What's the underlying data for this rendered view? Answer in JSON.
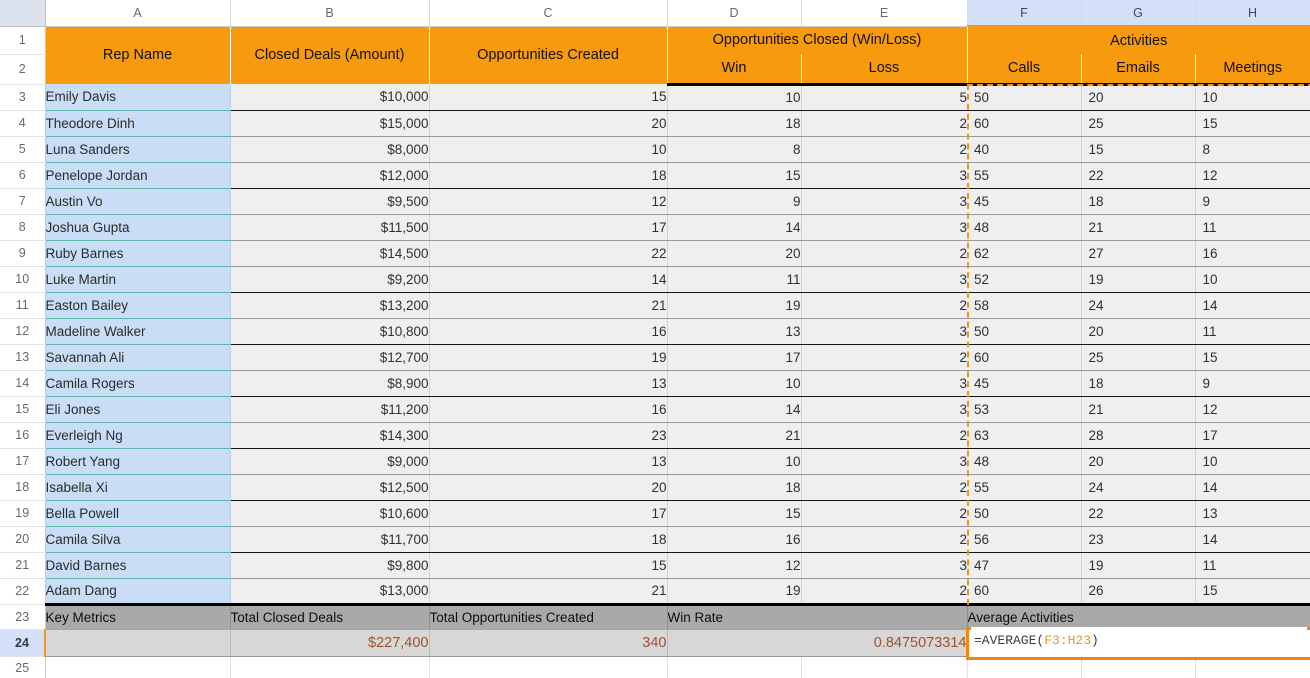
{
  "spreadsheet": {
    "column_letters": [
      "A",
      "B",
      "C",
      "D",
      "E",
      "F",
      "G",
      "H"
    ],
    "selected_columns": [
      "F",
      "G",
      "H"
    ],
    "active_row": "24",
    "row_numbers": [
      "1",
      "2",
      "3",
      "4",
      "5",
      "6",
      "7",
      "8",
      "9",
      "10",
      "11",
      "12",
      "13",
      "14",
      "15",
      "16",
      "17",
      "18",
      "19",
      "20",
      "21",
      "22",
      "23",
      "24",
      "25"
    ],
    "colors": {
      "header_orange": "#f79a0e",
      "name_column_blue": "#c9ddf7",
      "data_gray": "#efefef",
      "metric_label_gray": "#a9a9a9",
      "metric_value_gray": "#d7d7d7",
      "metric_value_text": "#a0522d",
      "selection_orange": "#f0921e",
      "column_header_selected": "#d3e0f7"
    }
  },
  "headers": {
    "rep_name": "Rep Name",
    "closed_deals": "Closed Deals (Amount)",
    "opportunities_created": "Opportunities Created",
    "opportunities_closed": "Opportunities Closed (Win/Loss)",
    "activities": "Activities",
    "win": "Win",
    "loss": "Loss",
    "calls": "Calls",
    "emails": "Emails",
    "meetings": "Meetings"
  },
  "rows": [
    {
      "row": "3",
      "name": "Emily Davis",
      "closed": "$10,000",
      "created": "15",
      "win": "10",
      "loss": "5",
      "calls": "50",
      "emails": "20",
      "meetings": "10"
    },
    {
      "row": "4",
      "name": "Theodore Dinh",
      "closed": "$15,000",
      "created": "20",
      "win": "18",
      "loss": "2",
      "calls": "60",
      "emails": "25",
      "meetings": "15"
    },
    {
      "row": "5",
      "name": "Luna Sanders",
      "closed": "$8,000",
      "created": "10",
      "win": "8",
      "loss": "2",
      "calls": "40",
      "emails": "15",
      "meetings": "8"
    },
    {
      "row": "6",
      "name": "Penelope Jordan",
      "closed": "$12,000",
      "created": "18",
      "win": "15",
      "loss": "3",
      "calls": "55",
      "emails": "22",
      "meetings": "12"
    },
    {
      "row": "7",
      "name": "Austin Vo",
      "closed": "$9,500",
      "created": "12",
      "win": "9",
      "loss": "3",
      "calls": "45",
      "emails": "18",
      "meetings": "9"
    },
    {
      "row": "8",
      "name": "Joshua Gupta",
      "closed": "$11,500",
      "created": "17",
      "win": "14",
      "loss": "3",
      "calls": "48",
      "emails": "21",
      "meetings": "11"
    },
    {
      "row": "9",
      "name": "Ruby Barnes",
      "closed": "$14,500",
      "created": "22",
      "win": "20",
      "loss": "2",
      "calls": "62",
      "emails": "27",
      "meetings": "16"
    },
    {
      "row": "10",
      "name": "Luke Martin",
      "closed": "$9,200",
      "created": "14",
      "win": "11",
      "loss": "3",
      "calls": "52",
      "emails": "19",
      "meetings": "10"
    },
    {
      "row": "11",
      "name": "Easton Bailey",
      "closed": "$13,200",
      "created": "21",
      "win": "19",
      "loss": "2",
      "calls": "58",
      "emails": "24",
      "meetings": "14"
    },
    {
      "row": "12",
      "name": "Madeline Walker",
      "closed": "$10,800",
      "created": "16",
      "win": "13",
      "loss": "3",
      "calls": "50",
      "emails": "20",
      "meetings": "11"
    },
    {
      "row": "13",
      "name": "Savannah Ali",
      "closed": "$12,700",
      "created": "19",
      "win": "17",
      "loss": "2",
      "calls": "60",
      "emails": "25",
      "meetings": "15"
    },
    {
      "row": "14",
      "name": "Camila Rogers",
      "closed": "$8,900",
      "created": "13",
      "win": "10",
      "loss": "3",
      "calls": "45",
      "emails": "18",
      "meetings": "9"
    },
    {
      "row": "15",
      "name": "Eli Jones",
      "closed": "$11,200",
      "created": "16",
      "win": "14",
      "loss": "3",
      "calls": "53",
      "emails": "21",
      "meetings": "12"
    },
    {
      "row": "16",
      "name": "Everleigh Ng",
      "closed": "$14,300",
      "created": "23",
      "win": "21",
      "loss": "2",
      "calls": "63",
      "emails": "28",
      "meetings": "17"
    },
    {
      "row": "17",
      "name": "Robert Yang",
      "closed": "$9,000",
      "created": "13",
      "win": "10",
      "loss": "3",
      "calls": "48",
      "emails": "20",
      "meetings": "10"
    },
    {
      "row": "18",
      "name": "Isabella Xi",
      "closed": "$12,500",
      "created": "20",
      "win": "18",
      "loss": "2",
      "calls": "55",
      "emails": "24",
      "meetings": "14"
    },
    {
      "row": "19",
      "name": "Bella Powell",
      "closed": "$10,600",
      "created": "17",
      "win": "15",
      "loss": "2",
      "calls": "50",
      "emails": "22",
      "meetings": "13"
    },
    {
      "row": "20",
      "name": "Camila Silva",
      "closed": "$11,700",
      "created": "18",
      "win": "16",
      "loss": "2",
      "calls": "56",
      "emails": "23",
      "meetings": "14"
    },
    {
      "row": "21",
      "name": "David Barnes",
      "closed": "$9,800",
      "created": "15",
      "win": "12",
      "loss": "3",
      "calls": "47",
      "emails": "19",
      "meetings": "11"
    },
    {
      "row": "22",
      "name": "Adam Dang",
      "closed": "$13,000",
      "created": "21",
      "win": "19",
      "loss": "2",
      "calls": "60",
      "emails": "26",
      "meetings": "15"
    }
  ],
  "summary": {
    "key_metrics_label": "Key Metrics",
    "total_closed_deals_label": "Total Closed Deals",
    "total_opportunities_created_label": "Total Opportunities Created",
    "win_rate_label": "Win Rate",
    "average_activities_label": "Average Activities",
    "key_metrics_value": "",
    "total_closed_deals_value": "$227,400",
    "total_opportunities_created_value": "340",
    "win_rate_value": "0.8475073314",
    "average_activities_formula_prefix": "=AVERAGE(",
    "average_activities_formula_ref": "F3:H23",
    "average_activities_formula_suffix": ")"
  }
}
